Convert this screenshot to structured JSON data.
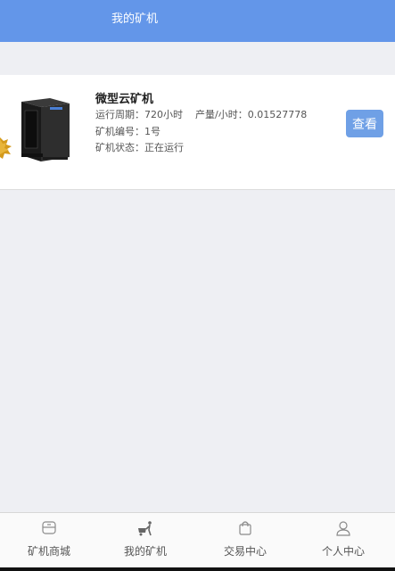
{
  "header": {
    "title": "我的矿机"
  },
  "miner": {
    "name": "微型云矿机",
    "period_label": "运行周期：",
    "period_value": "720小时",
    "output_label": "产量/小时：",
    "output_value": "0.01527778",
    "number_label": "矿机编号：",
    "number_value": "1号",
    "status_label": "矿机状态：",
    "status_value": "正在运行",
    "view_label": "查看",
    "image_icon": "server-tower-icon",
    "leaf_icon": "maple-leaf-icon"
  },
  "tabbar": {
    "items": [
      {
        "label": "矿机商城",
        "icon": "store-icon"
      },
      {
        "label": "我的矿机",
        "icon": "miner-cart-icon"
      },
      {
        "label": "交易中心",
        "icon": "shopping-bag-icon"
      },
      {
        "label": "个人中心",
        "icon": "user-icon"
      }
    ]
  },
  "colors": {
    "header": "#6396e9",
    "button": "#6fa0e6",
    "background": "#eeeff3"
  }
}
